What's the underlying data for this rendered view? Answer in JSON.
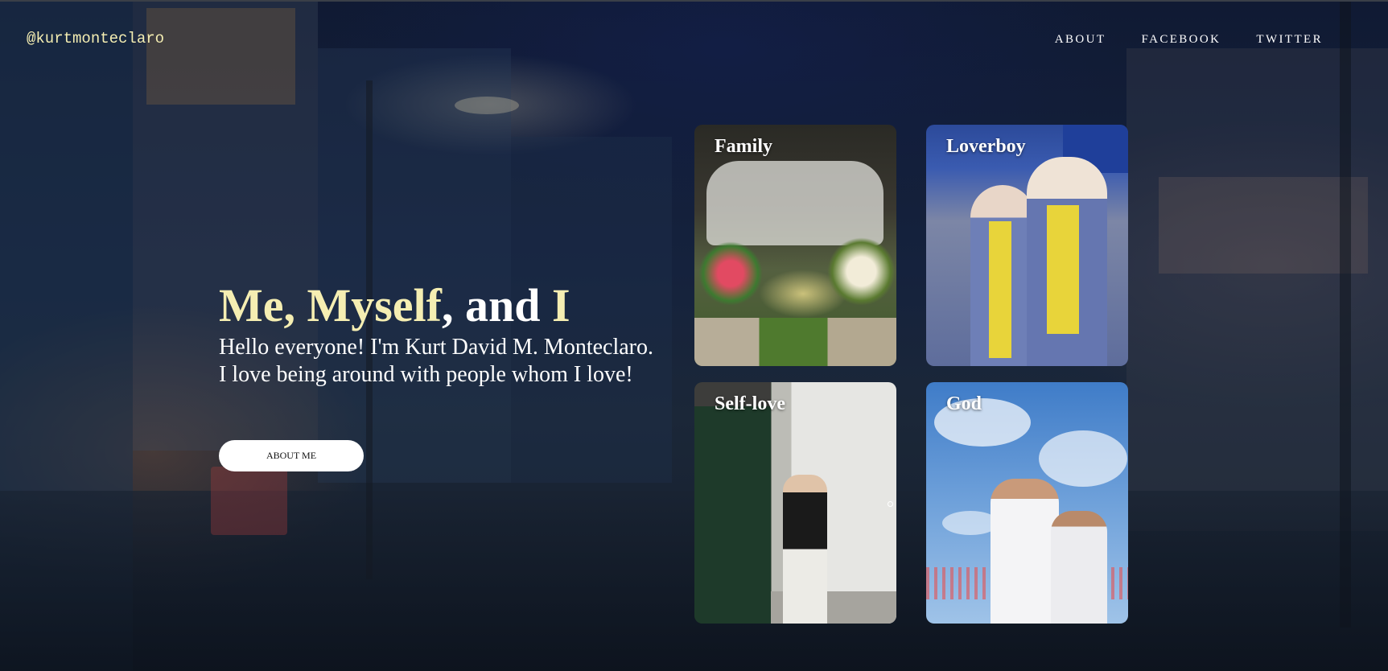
{
  "header": {
    "logo": "@kurtmonteclaro",
    "nav": [
      {
        "label": "ABOUT"
      },
      {
        "label": "FACEBOOK"
      },
      {
        "label": "TWITTER"
      }
    ]
  },
  "hero": {
    "title_part1": "Me, Myself",
    "title_part2": ", and ",
    "title_part3": "I",
    "intro": "Hello everyone! I'm Kurt David M. Monteclaro. I love being around with people whom I love!",
    "button_label": "ABOUT ME"
  },
  "gallery": [
    {
      "label": "Family"
    },
    {
      "label": "Loverboy"
    },
    {
      "label": "Self-love"
    },
    {
      "label": "God"
    }
  ],
  "colors": {
    "accent": "#f5eeb2",
    "text": "#ffffff",
    "button_bg": "#ffffff"
  }
}
